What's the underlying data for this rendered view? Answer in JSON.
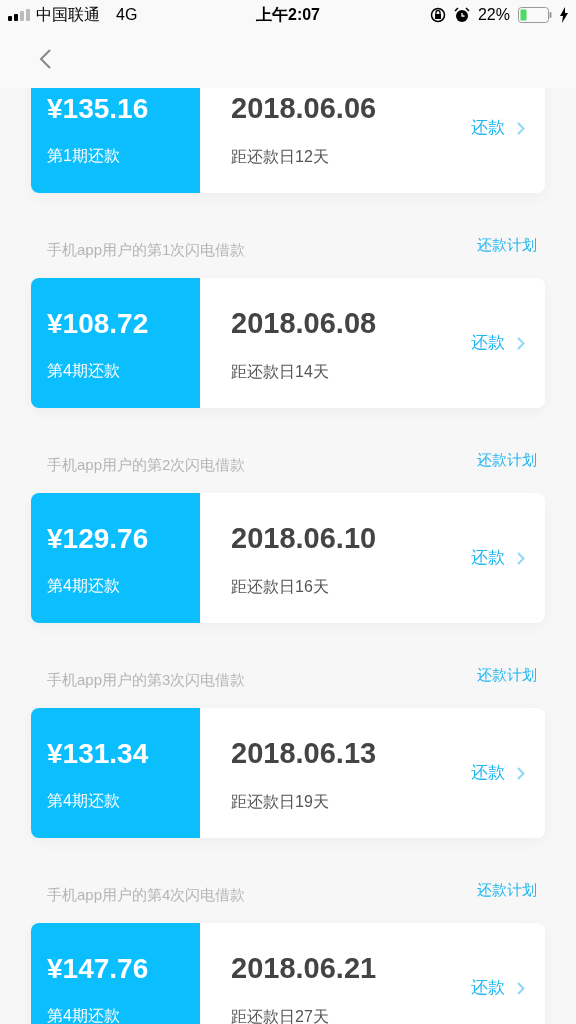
{
  "status_bar": {
    "carrier": "中国联通",
    "network": "4G",
    "time": "上午2:07",
    "battery": "22%"
  },
  "loans": [
    {
      "amount": "¥135.16",
      "period": "第1期还款",
      "date": "2018.06.06",
      "countdown": "距还款日12天",
      "action": "还款"
    },
    {
      "title": "手机app用户的第1次闪电借款",
      "plan_link": "还款计划",
      "amount": "¥108.72",
      "period": "第4期还款",
      "date": "2018.06.08",
      "countdown": "距还款日14天",
      "action": "还款"
    },
    {
      "title": "手机app用户的第2次闪电借款",
      "plan_link": "还款计划",
      "amount": "¥129.76",
      "period": "第4期还款",
      "date": "2018.06.10",
      "countdown": "距还款日16天",
      "action": "还款"
    },
    {
      "title": "手机app用户的第3次闪电借款",
      "plan_link": "还款计划",
      "amount": "¥131.34",
      "period": "第4期还款",
      "date": "2018.06.13",
      "countdown": "距还款日19天",
      "action": "还款"
    },
    {
      "title": "手机app用户的第4次闪电借款",
      "plan_link": "还款计划",
      "amount": "¥147.76",
      "period": "第4期还款",
      "date": "2018.06.21",
      "countdown": "距还款日27天",
      "action": "还款"
    }
  ]
}
